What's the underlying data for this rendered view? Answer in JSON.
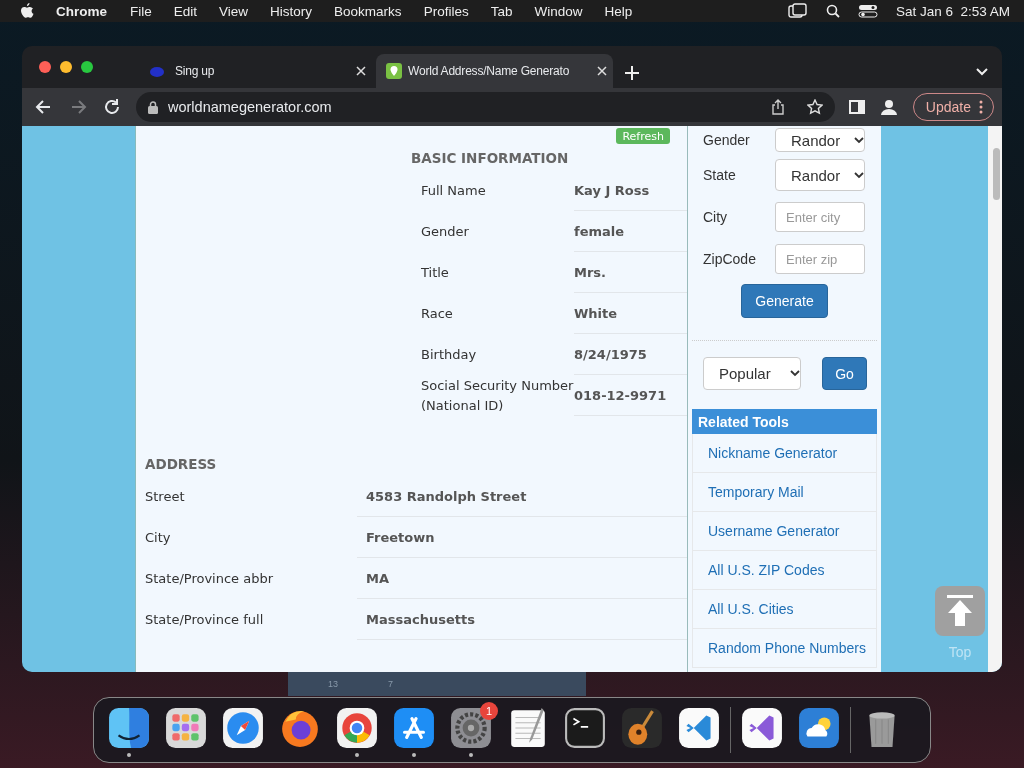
{
  "menubar": {
    "app": "Chrome",
    "items": [
      "File",
      "Edit",
      "View",
      "History",
      "Bookmarks",
      "Profiles",
      "Tab",
      "Window",
      "Help"
    ],
    "clock": "Sat Jan 6  2:53 AM"
  },
  "browser": {
    "tabs": [
      {
        "title": "Sing up",
        "selected": false
      },
      {
        "title": "World Address/Name Generato",
        "selected": true
      }
    ],
    "nav": [
      {
        "kind": "back",
        "disabled": false
      },
      {
        "kind": "forward",
        "disabled": true
      },
      {
        "kind": "reload",
        "disabled": false
      }
    ],
    "url": "worldnamegenerator.com",
    "update_label": "Update"
  },
  "page": {
    "refresh_label": "Refresh",
    "basic_heading": "BASIC INFORMATION",
    "basic_rows": [
      {
        "label": "Full Name",
        "value": "Kay J Ross"
      },
      {
        "label": "Gender",
        "value": "female"
      },
      {
        "label": "Title",
        "value": "Mrs."
      },
      {
        "label": "Race",
        "value": "White"
      },
      {
        "label": "Birthday",
        "value": "8/24/1975"
      },
      {
        "label": "Social Security Number (National ID)",
        "value": "018-12-9971"
      }
    ],
    "address_heading": "ADDRESS",
    "address_rows": [
      {
        "label": "Street",
        "value": "4583 Randolph Street"
      },
      {
        "label": "City",
        "value": "Freetown"
      },
      {
        "label": "State/Province abbr",
        "value": "MA"
      },
      {
        "label": "State/Province full",
        "value": "Massachusetts"
      }
    ],
    "sidebar": {
      "fields": [
        {
          "label": "Gender",
          "kind": "select",
          "value": "Randor"
        },
        {
          "label": "State",
          "kind": "select",
          "value": "Randor"
        },
        {
          "label": "City",
          "kind": "input",
          "placeholder": "Enter city"
        },
        {
          "label": "ZipCode",
          "kind": "input",
          "placeholder": "Enter zip"
        }
      ],
      "generate_label": "Generate",
      "popular_value": "Popular",
      "go_label": "Go",
      "related_heading": "Related Tools",
      "related_links": [
        "Nickname Generator",
        "Temporary Mail",
        "Username Generator",
        "All U.S. ZIP Codes",
        "All U.S. Cities",
        "Random Phone Numbers"
      ]
    },
    "top_label": "Top"
  },
  "background_texts": [
    "13",
    "7"
  ],
  "dock": {
    "groups": [
      {
        "items": [
          {
            "kind": "finder",
            "running": true
          },
          {
            "kind": "launchpad",
            "running": false
          },
          {
            "kind": "safari",
            "running": false
          },
          {
            "kind": "firefox",
            "running": false
          },
          {
            "kind": "chrome",
            "running": true
          },
          {
            "kind": "appstore",
            "running": true
          },
          {
            "kind": "settings",
            "running": true,
            "badge": "1"
          },
          {
            "kind": "textedit",
            "running": false
          },
          {
            "kind": "terminal",
            "running": false
          },
          {
            "kind": "garageband",
            "running": false
          },
          {
            "kind": "vscode",
            "running": false
          }
        ]
      },
      {
        "items": [
          {
            "kind": "visualstudio",
            "running": false
          },
          {
            "kind": "weather",
            "running": false
          }
        ]
      },
      {
        "items": [
          {
            "kind": "trash",
            "running": false
          }
        ]
      }
    ]
  }
}
